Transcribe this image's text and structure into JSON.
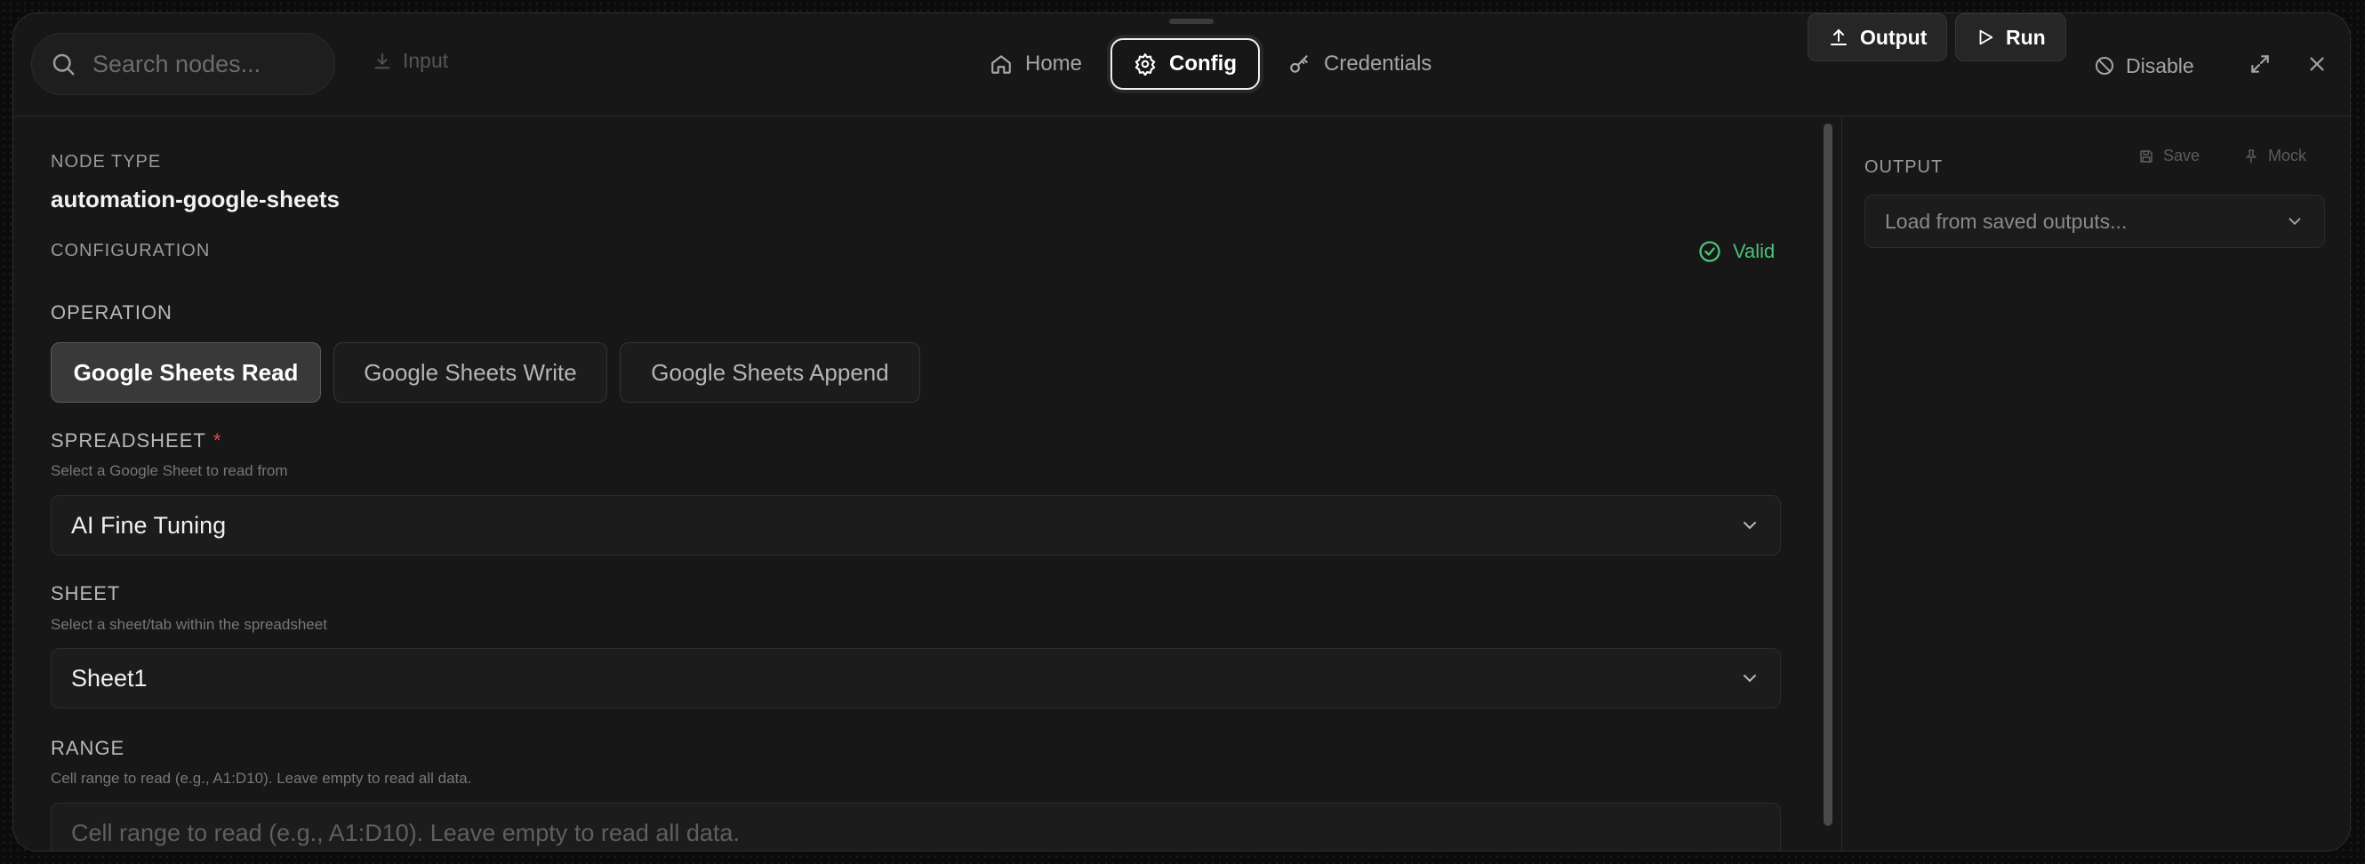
{
  "topbar": {
    "search_placeholder": "Search nodes...",
    "input_label": "Input",
    "tabs": [
      {
        "label": "Home",
        "icon": "home-icon"
      },
      {
        "label": "Config",
        "icon": "gear-icon"
      },
      {
        "label": "Credentials",
        "icon": "key-icon"
      }
    ],
    "active_tab": "Config",
    "output_label": "Output",
    "run_label": "Run",
    "disable_label": "Disable"
  },
  "config": {
    "node_type_label": "NODE TYPE",
    "node_type_value": "automation-google-sheets",
    "configuration_label": "CONFIGURATION",
    "valid_label": "Valid",
    "operation_label": "OPERATION",
    "operations": [
      "Google Sheets Read",
      "Google Sheets Write",
      "Google Sheets Append"
    ],
    "selected_operation": "Google Sheets Read",
    "spreadsheet": {
      "label": "SPREADSHEET",
      "required_mark": "*",
      "hint": "Select a Google Sheet to read from",
      "value": "AI Fine Tuning"
    },
    "sheet": {
      "label": "SHEET",
      "hint": "Select a sheet/tab within the spreadsheet",
      "value": "Sheet1"
    },
    "range": {
      "label": "RANGE",
      "hint": "Cell range to read (e.g., A1:D10). Leave empty to read all data.",
      "placeholder": "Cell range to read (e.g., A1:D10). Leave empty to read all data."
    }
  },
  "output": {
    "label": "OUTPUT",
    "save_label": "Save",
    "mock_label": "Mock",
    "select_placeholder": "Load from saved outputs..."
  },
  "colors": {
    "valid": "#4cc17a",
    "required": "#e5484d",
    "panel_bg": "#171717"
  }
}
